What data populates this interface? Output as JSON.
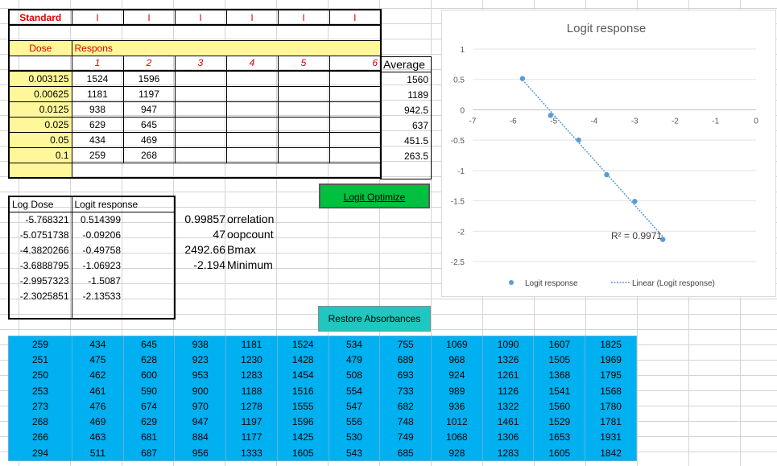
{
  "standard_table": {
    "title": "Standard",
    "header_marks": [
      "I",
      "I",
      "I",
      "I",
      "I",
      "I"
    ],
    "dose_label": "Dose",
    "response_label": "Respons",
    "rep_numbers": [
      "1",
      "2",
      "3",
      "4",
      "5",
      "6"
    ],
    "average_label": "Average",
    "rows": [
      {
        "dose": "0.003125",
        "r1": "1524",
        "r2": "1596",
        "avg": "1560"
      },
      {
        "dose": "0.00625",
        "r1": "1181",
        "r2": "1197",
        "avg": "1189"
      },
      {
        "dose": "0.0125",
        "r1": "938",
        "r2": "947",
        "avg": "942.5"
      },
      {
        "dose": "0.025",
        "r1": "629",
        "r2": "645",
        "avg": "637"
      },
      {
        "dose": "0.05",
        "r1": "434",
        "r2": "469",
        "avg": "451.5"
      },
      {
        "dose": "0.1",
        "r1": "259",
        "r2": "268",
        "avg": "263.5"
      }
    ]
  },
  "logit_table": {
    "col1": "Log Dose",
    "col2": "Logit response",
    "rows": [
      [
        "-5.768321",
        "0.514399"
      ],
      [
        "-5.0751738",
        "-0.09206"
      ],
      [
        "-4.3820266",
        "-0.49758"
      ],
      [
        "-3.6888795",
        "-1.06923"
      ],
      [
        "-2.9957323",
        "-1.5087"
      ],
      [
        "-2.3025851",
        "-2.13533"
      ]
    ]
  },
  "stats": [
    {
      "value": "0.99857",
      "label": "orrelation"
    },
    {
      "value": "47",
      "label": "oopcount"
    },
    {
      "value": "2492.66",
      "label": "Bmax"
    },
    {
      "value": "-2.194",
      "label": "Minimum"
    }
  ],
  "buttons": {
    "logit_optimize": "Logit Optimize",
    "restore": "Restore Absorbances"
  },
  "absorbance_grid": [
    [
      "259",
      "434",
      "645",
      "938",
      "1181",
      "1524",
      "534",
      "755",
      "1069",
      "1090",
      "1607",
      "1825"
    ],
    [
      "251",
      "475",
      "628",
      "923",
      "1230",
      "1428",
      "479",
      "689",
      "968",
      "1326",
      "1505",
      "1969"
    ],
    [
      "250",
      "462",
      "600",
      "953",
      "1283",
      "1454",
      "508",
      "693",
      "924",
      "1261",
      "1368",
      "1795"
    ],
    [
      "253",
      "461",
      "590",
      "900",
      "1188",
      "1516",
      "554",
      "733",
      "989",
      "1126",
      "1541",
      "1568"
    ],
    [
      "273",
      "476",
      "674",
      "970",
      "1278",
      "1555",
      "547",
      "682",
      "936",
      "1322",
      "1560",
      "1780"
    ],
    [
      "268",
      "469",
      "629",
      "947",
      "1197",
      "1596",
      "556",
      "748",
      "1012",
      "1461",
      "1529",
      "1781"
    ],
    [
      "266",
      "463",
      "681",
      "884",
      "1177",
      "1425",
      "530",
      "749",
      "1068",
      "1306",
      "1653",
      "1931"
    ],
    [
      "294",
      "511",
      "687",
      "956",
      "1333",
      "1605",
      "543",
      "685",
      "928",
      "1283",
      "1605",
      "1842"
    ]
  ],
  "colors": {
    "yellow": "#fff799",
    "green_button": "#00c040",
    "teal_button": "#1ec8c0",
    "blue_grid": "#00b0f0",
    "series": "#5b9bd5",
    "red_text": "#e00000"
  },
  "chart_data": {
    "type": "scatter",
    "title": "Logit response",
    "x": [
      -5.768321,
      -5.0751738,
      -4.3820266,
      -3.6888795,
      -2.9957323,
      -2.3025851
    ],
    "series": [
      {
        "name": "Logit response",
        "values": [
          0.514399,
          -0.09206,
          -0.49758,
          -1.06923,
          -1.5087,
          -2.13533
        ]
      }
    ],
    "trendline": {
      "type": "linear",
      "legend": "Linear (Logit response)",
      "r2_label": "R² = 0.9971"
    },
    "xlim": [
      -7,
      0
    ],
    "ylim": [
      -2.5,
      1
    ],
    "x_ticks": [
      "-7",
      "-6",
      "-5",
      "-4",
      "-3",
      "-2",
      "-1",
      "0"
    ],
    "y_ticks": [
      "1",
      "0.5",
      "0",
      "-0.5",
      "-1",
      "-1.5",
      "-2",
      "-2.5"
    ],
    "grid": true,
    "legend_position": "bottom"
  }
}
